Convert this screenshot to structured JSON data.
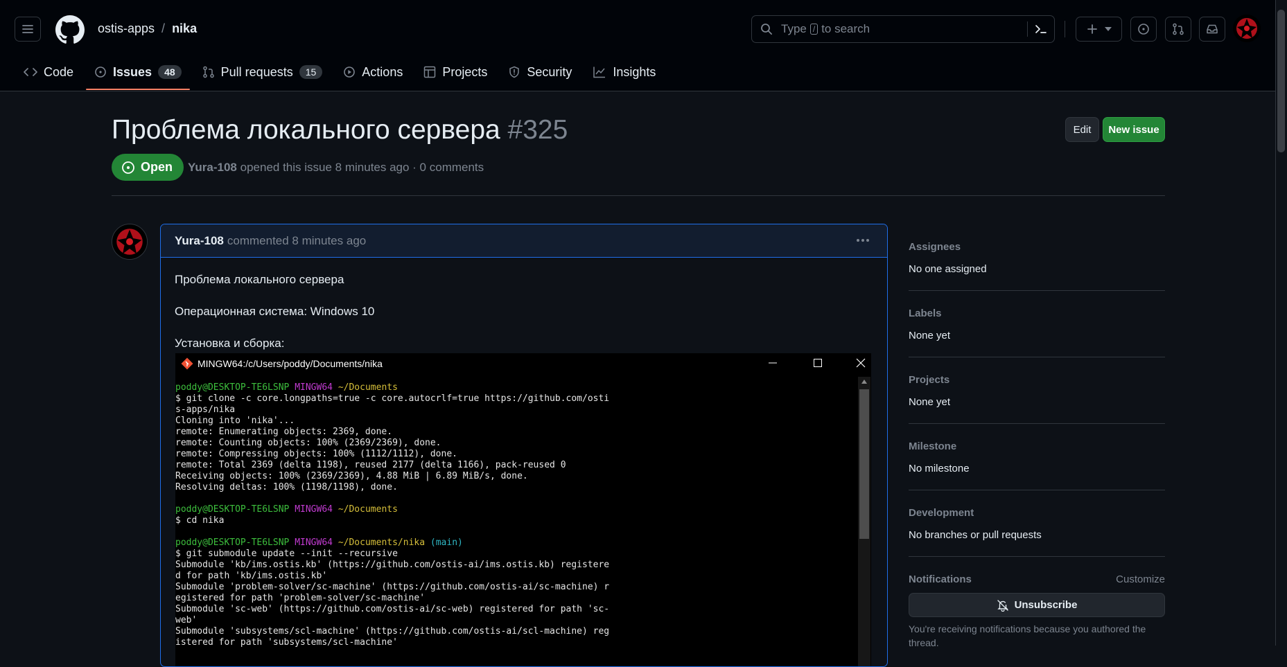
{
  "header": {
    "owner": "ostis-apps",
    "separator": "/",
    "repo": "nika",
    "search": {
      "prefix": "Type",
      "key": "/",
      "suffix": "to search"
    }
  },
  "tabs": [
    {
      "label": "Code",
      "icon": "code-icon"
    },
    {
      "label": "Issues",
      "count": "48",
      "icon": "issue-opened-icon",
      "active": true
    },
    {
      "label": "Pull requests",
      "count": "15",
      "icon": "git-pull-request-icon"
    },
    {
      "label": "Actions",
      "icon": "play-icon"
    },
    {
      "label": "Projects",
      "icon": "table-icon"
    },
    {
      "label": "Security",
      "icon": "shield-icon"
    },
    {
      "label": "Insights",
      "icon": "graph-icon"
    }
  ],
  "issue": {
    "title": "Проблема локального сервера",
    "number": "#325",
    "state": "Open",
    "author": "Yura-108",
    "meta": "opened this issue 8 minutes ago · 0 comments"
  },
  "buttons": {
    "edit": "Edit",
    "new_issue": "New issue"
  },
  "comment": {
    "author": "Yura-108",
    "time": "commented 8 minutes ago",
    "lines": [
      "Проблема локального сервера",
      "Операционная система: Windows 10",
      "Установка и сборка:"
    ]
  },
  "terminal": {
    "title": "MINGW64:/c/Users/poddy/Documents/nika",
    "prompt_user": "poddy@DESKTOP-TE6LSNP",
    "prompt_env": "MINGW64",
    "dir1": "~/Documents",
    "dir2": "~/Documents/nika",
    "branch": "(main)",
    "cmd1": "$ git clone -c core.longpaths=true -c core.autocrlf=true https://github.com/osti",
    "out1": [
      "s-apps/nika",
      "Cloning into 'nika'...",
      "remote: Enumerating objects: 2369, done.",
      "remote: Counting objects: 100% (2369/2369), done.",
      "remote: Compressing objects: 100% (1112/1112), done.",
      "remote: Total 2369 (delta 1198), reused 2177 (delta 1166), pack-reused 0",
      "Receiving objects: 100% (2369/2369), 4.88 MiB | 6.89 MiB/s, done.",
      "Resolving deltas: 100% (1198/1198), done."
    ],
    "cmd2": "$ cd nika",
    "cmd3": "$ git submodule update --init --recursive",
    "out3": [
      "Submodule 'kb/ims.ostis.kb' (https://github.com/ostis-ai/ims.ostis.kb) registere",
      "d for path 'kb/ims.ostis.kb'",
      "Submodule 'problem-solver/sc-machine' (https://github.com/ostis-ai/sc-machine) r",
      "egistered for path 'problem-solver/sc-machine'",
      "Submodule 'sc-web' (https://github.com/ostis-ai/sc-web) registered for path 'sc-",
      "web'",
      "Submodule 'subsystems/scl-machine' (https://github.com/ostis-ai/scl-machine) reg",
      "istered for path 'subsystems/scl-machine'"
    ]
  },
  "sidebar": {
    "assignees": {
      "label": "Assignees",
      "value": "No one assigned"
    },
    "labels": {
      "label": "Labels",
      "value": "None yet"
    },
    "projects": {
      "label": "Projects",
      "value": "None yet"
    },
    "milestone": {
      "label": "Milestone",
      "value": "No milestone"
    },
    "development": {
      "label": "Development",
      "value": "No branches or pull requests"
    },
    "notifications": {
      "label": "Notifications",
      "customize": "Customize",
      "button": "Unsubscribe",
      "note": "You're receiving notifications because you authored the thread."
    }
  },
  "colors": {
    "accent": "#1f6feb",
    "open": "#238636",
    "tab_underline": "#f78166",
    "bg": "#0d1117"
  }
}
